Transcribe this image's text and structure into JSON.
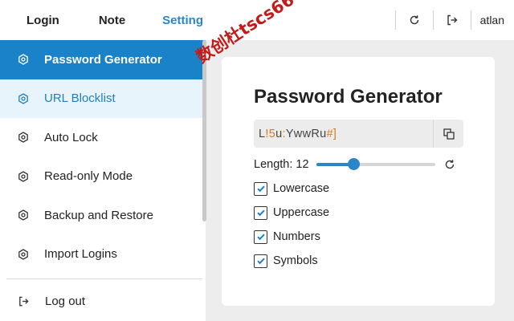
{
  "topbar": {
    "tabs": [
      "Login",
      "Note",
      "Setting"
    ],
    "active_tab": "Setting",
    "user": "atlan",
    "icons": [
      "refresh-icon",
      "logout-icon"
    ]
  },
  "watermark": "数创杜tscs66",
  "sidebar": {
    "items": [
      {
        "label": "Password Generator",
        "icon": "gear-icon",
        "state": "active"
      },
      {
        "label": "URL Blocklist",
        "icon": "gear-icon",
        "state": "hover"
      },
      {
        "label": "Auto Lock",
        "icon": "gear-icon"
      },
      {
        "label": "Read-only Mode",
        "icon": "gear-icon"
      },
      {
        "label": "Backup and Restore",
        "icon": "gear-icon"
      },
      {
        "label": "Import Logins",
        "icon": "gear-icon"
      }
    ],
    "logout_label": "Log out"
  },
  "generator": {
    "title": "Password Generator",
    "password": "L!5u:YwwRu#]",
    "length_label": "Length: 12",
    "length": 12,
    "length_range": [
      4,
      30
    ],
    "options": [
      {
        "label": "Lowercase",
        "checked": true
      },
      {
        "label": "Uppercase",
        "checked": true
      },
      {
        "label": "Numbers",
        "checked": true
      },
      {
        "label": "Symbols",
        "checked": true
      }
    ]
  },
  "colors": {
    "accent": "#1a82c8",
    "symbol": "#d67a1b",
    "hover_bg": "#e7f4fc"
  }
}
